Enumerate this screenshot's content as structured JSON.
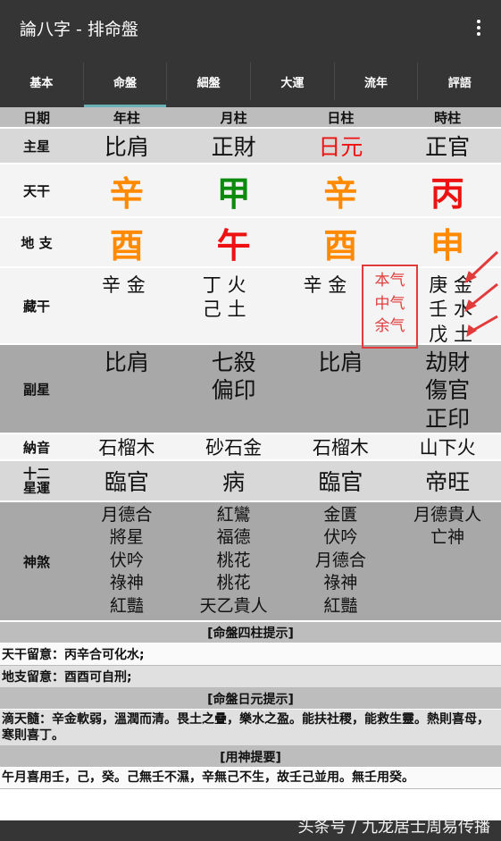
{
  "app": {
    "title": "論八字 - 排命盤"
  },
  "tabs": [
    "基本",
    "命盤",
    "細盤",
    "大運",
    "流年",
    "評語"
  ],
  "active_tab": 1,
  "header": {
    "label": "日期",
    "cols": [
      "年柱",
      "月柱",
      "日柱",
      "時柱"
    ]
  },
  "rows": {
    "main_star": {
      "label": "主星",
      "cols": [
        "比肩",
        "正財",
        "日元",
        "正官"
      ]
    },
    "heaven": {
      "label": "天干",
      "cols": [
        "辛",
        "甲",
        "辛",
        "丙"
      ]
    },
    "earth": {
      "label": "地 支",
      "cols": [
        "酉",
        "午",
        "酉",
        "申"
      ]
    },
    "hidden": {
      "label": "藏干",
      "cols": [
        [
          "辛 金"
        ],
        [
          "丁 火",
          "己 土"
        ],
        [
          "辛 金"
        ],
        [
          "庚 金",
          "壬 水",
          "戊 土"
        ]
      ],
      "annotation": [
        "本气",
        "中气",
        "余气"
      ]
    },
    "sub_star": {
      "label": "副星",
      "cols": [
        [
          "比肩"
        ],
        [
          "七殺",
          "偏印"
        ],
        [
          "比肩"
        ],
        [
          "劫財",
          "傷官",
          "正印"
        ]
      ]
    },
    "nayin": {
      "label": "納音",
      "cols": [
        "石榴木",
        "砂石金",
        "石榴木",
        "山下火"
      ]
    },
    "twelve": {
      "label_lines": [
        "十二",
        "星運"
      ],
      "cols": [
        "臨官",
        "病",
        "臨官",
        "帝旺"
      ]
    },
    "shensha": {
      "label": "神煞",
      "cols": [
        [
          "月德合",
          "將星",
          "伏吟",
          "祿神",
          "紅豔"
        ],
        [
          "紅鸞",
          "福德",
          "桃花",
          "桃花",
          "天乙貴人"
        ],
        [
          "金匱",
          "伏吟",
          "月德合",
          "祿神",
          "紅豔"
        ],
        [
          "月德貴人",
          "亡神"
        ]
      ]
    }
  },
  "sections": [
    {
      "title": "[命盤四柱提示]",
      "notes": [
        "天干留意：丙辛合可化水;",
        "地支留意：酉酉可自刑;"
      ]
    },
    {
      "title": "[命盤日元提示]",
      "notes": [
        "滴天髓：辛金軟弱，溫潤而清。畏土之疊，樂水之盈。能扶社稷，能救生靈。熱則喜母，寒則喜丁。"
      ]
    },
    {
      "title": "[用神提要]",
      "notes": [
        "午月喜用壬，己，癸。己無壬不濕，辛無己不生，故壬己並用。無壬用癸。"
      ]
    }
  ],
  "watermark": "头条号 / 九龙居士周易传播",
  "colors": {
    "bar": "#353535",
    "tab_indicator": "#6ab0b5",
    "red": "#ee1111",
    "orange": "#ff8a00",
    "green": "#0b8a0b"
  }
}
